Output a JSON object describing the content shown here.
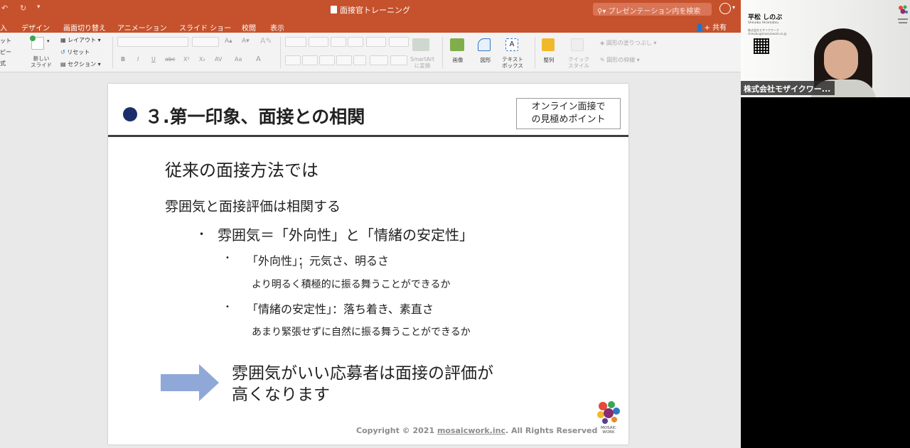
{
  "window": {
    "document_title": "面接官トレーニング",
    "search_placeholder": "プレゼンテーション内を検索",
    "share_label": "共有",
    "accent_color": "#c5522c"
  },
  "tabs": [
    "入",
    "デザイン",
    "画面切り替え",
    "アニメーション",
    "スライド ショー",
    "校閲",
    "表示"
  ],
  "ribbon": {
    "left_partial": [
      "ット",
      "ピー",
      "式"
    ],
    "new_slide": "新しい\nスライド",
    "layout": "レイアウト",
    "reset": "リセット",
    "section": "セクション",
    "font_buttons": [
      "B",
      "I",
      "U",
      "abc",
      "X²",
      "X₂",
      "AV",
      "Aa",
      "A"
    ],
    "smartart": "SmartArt\nに変換",
    "picture": "画像",
    "shapes": "図形",
    "textbox": "テキスト\nボックス",
    "arrange": "整列",
    "quick_style": "クイック\nスタイル",
    "shape_fill": "図形の塗りつぶし",
    "shape_outline": "図形の枠線"
  },
  "slide": {
    "title": "３.第一印象、面接との相関",
    "badge": "オンライン面接で\nの見極めポイント",
    "heading": "従来の面接方法では",
    "line1": "雰囲気と面接評価は相関する",
    "bullet1": "雰囲気＝「外向性」と「情緒の安定性」",
    "sub1": "「外向性」：元気さ、明るさ",
    "sub1_detail": "より明るく積極的に振る舞うことができるか",
    "sub2": "「情緒の安定性」：落ち着き、素直さ",
    "sub2_detail": "あまり緊張せずに自然に振る舞うことができるか",
    "conclusion_line1": "雰囲気がいい応募者は面接の評価が",
    "conclusion_line2": "高くなります",
    "copyright_prefix": "Copyright © 2021 ",
    "copyright_link": "mosaicwork.inc",
    "copyright_suffix": ". All Rights Reserved",
    "logo_text": "MOSAIC\nWORK",
    "title_bullet_color": "#1b2d6b",
    "arrow_color": "#8fa8d8"
  },
  "video": {
    "business_card_name": "平松 しのぶ",
    "business_card_roman": "Shinobu Hiramatsu",
    "business_card_company": "株式会社モザイクワーク\nshinobu@mosaicwork.co.jp",
    "participant_label": "株式会社モザイクワー..."
  }
}
